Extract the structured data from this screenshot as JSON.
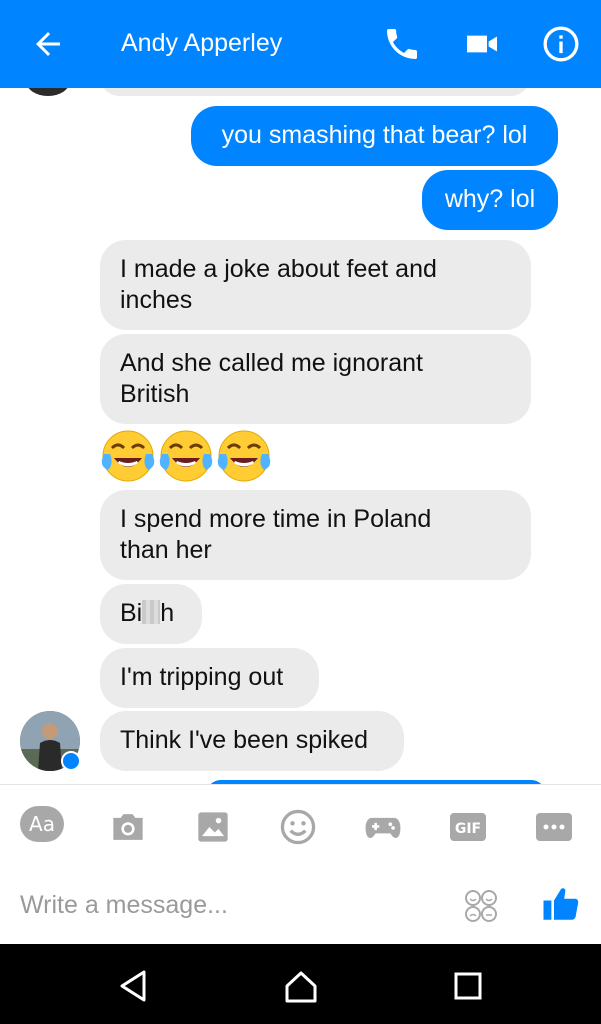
{
  "header": {
    "title": "Andy Apperley",
    "back_icon": "arrow-left-icon",
    "call_icon": "phone-icon",
    "video_icon": "video-camera-icon",
    "info_icon": "info-icon",
    "background": "#0084ff"
  },
  "messages": [
    {
      "direction": "outgoing",
      "text": "you smashing that bear? lol"
    },
    {
      "direction": "outgoing",
      "text": "why? lol"
    },
    {
      "direction": "incoming",
      "text": "I made a joke about feet and\ninches"
    },
    {
      "direction": "incoming",
      "text": "And she called me ignorant\nBritish"
    },
    {
      "direction": "incoming",
      "emoji": [
        "face-with-tears-of-joy",
        "face-with-tears-of-joy",
        "face-with-tears-of-joy"
      ]
    },
    {
      "direction": "incoming",
      "text": "I spend more time in Poland\nthan her"
    },
    {
      "direction": "incoming",
      "text_before": "Bi",
      "text_after": "h",
      "censored": true
    },
    {
      "direction": "incoming",
      "text": "I'm tripping out"
    },
    {
      "direction": "incoming",
      "text": "Think I've been spiked"
    }
  ],
  "composer": {
    "aa_label": "Aa",
    "gif_label": "GIF",
    "placeholder": "Write a message...",
    "tools": [
      "aa-icon",
      "camera-icon",
      "image-icon",
      "emoji-icon",
      "game-controller-icon",
      "gif-icon",
      "more-icon"
    ]
  },
  "colors": {
    "accent": "#0084ff",
    "incoming_bubble": "#ebebeb",
    "tool_gray": "#a8a8a8"
  }
}
